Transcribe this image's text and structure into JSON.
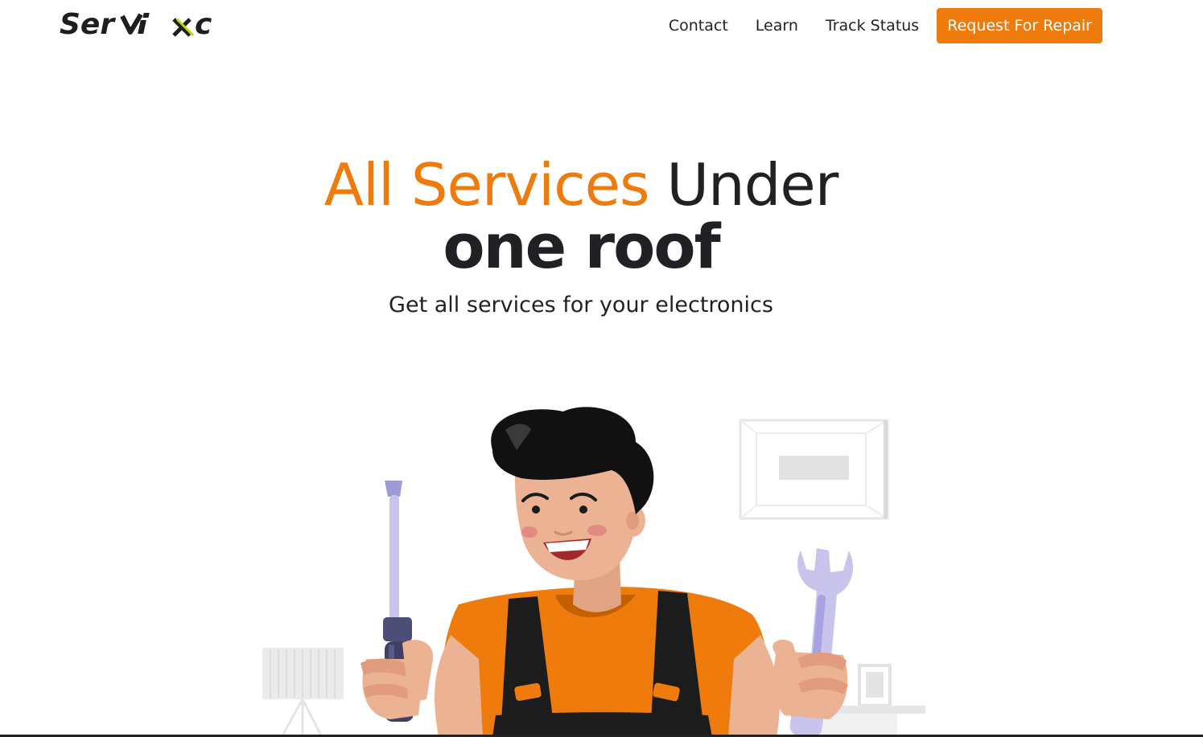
{
  "brand": {
    "logo_text_left": "Ser",
    "logo_text_v": "V",
    "logo_text_i": "i",
    "logo_text_right": "c",
    "logo_full": "Servixc",
    "accent_color": "#ee7b0b",
    "mark_color": "#c8d400"
  },
  "nav": {
    "links": [
      "Contact",
      "Learn",
      "Track Status"
    ],
    "cta_label": "Request For Repair"
  },
  "hero": {
    "headline_accent": "All Services",
    "headline_rest": "Under",
    "headline_bold": "one roof",
    "subtitle": "Get all services for your electronics"
  },
  "illustration": {
    "subject": "repair-technician",
    "left_tool": "screwdriver-icon",
    "right_tool": "wrench-icon",
    "shirt_color": "#ee7b0b",
    "overall_color": "#1c1c1c",
    "skin_color": "#ebb394",
    "hair_color": "#111111",
    "tool_color": "#c8c4ec"
  }
}
